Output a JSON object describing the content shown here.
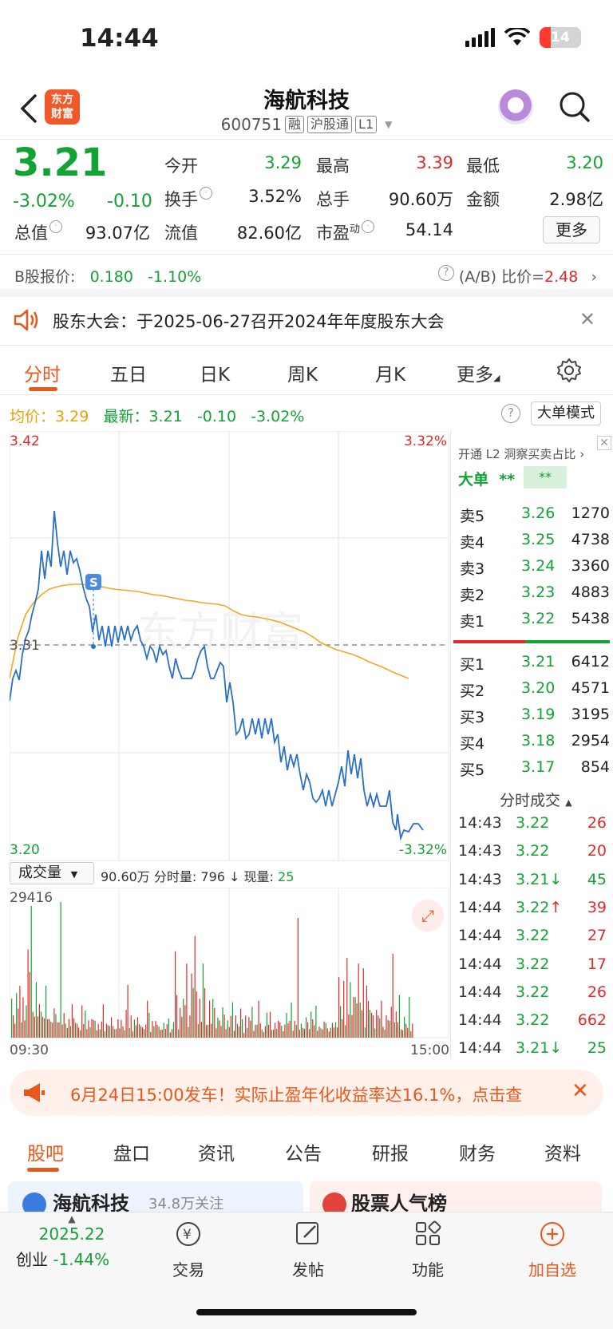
{
  "status": {
    "time": "14:44",
    "battery": "14"
  },
  "header": {
    "app_logo": "东方\n财富",
    "stock_name": "海航科技",
    "code": "600751",
    "tags": [
      "融",
      "沪股通",
      "L1"
    ],
    "icons": [
      "back-icon",
      "robot-icon",
      "search-icon"
    ]
  },
  "quote": {
    "price": "3.21",
    "change_pct": "-3.02%",
    "change_abs": "-0.10",
    "fields": {
      "open_label": "今开",
      "open": "3.29",
      "high_label": "最高",
      "high": "3.39",
      "low_label": "最低",
      "low": "3.20",
      "turnover_label": "换手",
      "turnover": "3.52%",
      "volume_label": "总手",
      "volume": "90.60万",
      "amount_label": "金额",
      "amount": "2.98亿",
      "mktcap_label": "总值",
      "mktcap": "93.07亿",
      "float_label": "流值",
      "float": "82.60亿",
      "pe_label": "市盈",
      "pe_sup": "动",
      "pe": "54.14"
    },
    "more_button": "更多"
  },
  "bshare": {
    "label": "B股报价:",
    "price": "0.180",
    "change": "-1.10%",
    "ratio_label": "(A/B) 比价=",
    "ratio": "2.48"
  },
  "notice": {
    "text": "股东大会：于2025-06-27召开2024年年度股东大会"
  },
  "chart_tabs": [
    "分时",
    "五日",
    "日K",
    "周K",
    "月K",
    "更多"
  ],
  "info_line": {
    "avg_label": "均价：",
    "avg": "3.29",
    "latest_label": "最新：",
    "latest": "3.21",
    "chg": "-0.10",
    "chg_pct": "-3.02%",
    "big_order_button": "大单模式"
  },
  "chart_axes": {
    "top_left": "3.42",
    "top_right": "3.32%",
    "mid": "3.31",
    "bottom_left": "3.20",
    "bottom_right": "-3.32%",
    "watermark": "东方财富",
    "marker": "S"
  },
  "volume_panel": {
    "selector": "成交量",
    "total": "90.60万",
    "minute_label": "分时量:",
    "minute": "796",
    "current_label": "现量:",
    "current": "25",
    "max": "29416",
    "time_start": "09:30",
    "time_end": "15:00"
  },
  "order_book": {
    "l2_tip": "开通 L2 洞察买卖占比",
    "big_label": "大单",
    "big_a": "**",
    "big_b": "**",
    "asks": [
      {
        "label": "卖5",
        "price": "3.26",
        "vol": "1270"
      },
      {
        "label": "卖4",
        "price": "3.25",
        "vol": "4738"
      },
      {
        "label": "卖3",
        "price": "3.24",
        "vol": "3360"
      },
      {
        "label": "卖2",
        "price": "3.23",
        "vol": "4883"
      },
      {
        "label": "卖1",
        "price": "3.22",
        "vol": "5438"
      }
    ],
    "bids": [
      {
        "label": "买1",
        "price": "3.21",
        "vol": "6412"
      },
      {
        "label": "买2",
        "price": "3.20",
        "vol": "4571"
      },
      {
        "label": "买3",
        "price": "3.19",
        "vol": "3195"
      },
      {
        "label": "买4",
        "price": "3.18",
        "vol": "2954"
      },
      {
        "label": "买5",
        "price": "3.17",
        "vol": "854"
      }
    ],
    "trades_title": "分时成交",
    "trades": [
      {
        "t": "14:43",
        "p": "3.22",
        "v": "26",
        "dir": ""
      },
      {
        "t": "14:43",
        "p": "3.22",
        "v": "20",
        "dir": ""
      },
      {
        "t": "14:43",
        "p": "3.21",
        "v": "45",
        "dir": "↓"
      },
      {
        "t": "14:44",
        "p": "3.22",
        "v": "39",
        "dir": "↑"
      },
      {
        "t": "14:44",
        "p": "3.22",
        "v": "27",
        "dir": ""
      },
      {
        "t": "14:44",
        "p": "3.22",
        "v": "17",
        "dir": ""
      },
      {
        "t": "14:44",
        "p": "3.22",
        "v": "26",
        "dir": ""
      },
      {
        "t": "14:44",
        "p": "3.22",
        "v": "662",
        "dir": ""
      },
      {
        "t": "14:44",
        "p": "3.21",
        "v": "25",
        "dir": "↓"
      }
    ]
  },
  "promo": {
    "text": "6月24日15:00发车！实际止盈年化收益率达16.1%，点击查"
  },
  "bottom_tabs": [
    "股吧",
    "盘口",
    "资讯",
    "公告",
    "研报",
    "财务",
    "资料"
  ],
  "peek": {
    "left": "海航科技",
    "left_sub": "34.8万关注",
    "right": "股票人气榜"
  },
  "bottom_nav": {
    "index_value": "2025.22",
    "index_name": "创业",
    "index_change": "-1.44%",
    "items": [
      "交易",
      "发帖",
      "功能",
      "加自选"
    ]
  },
  "colors": {
    "up": "#e02a2a",
    "down": "#13a334",
    "price_line": "#2a6fc9",
    "avg_line": "#f5a623",
    "accent": "#e8571b"
  }
}
